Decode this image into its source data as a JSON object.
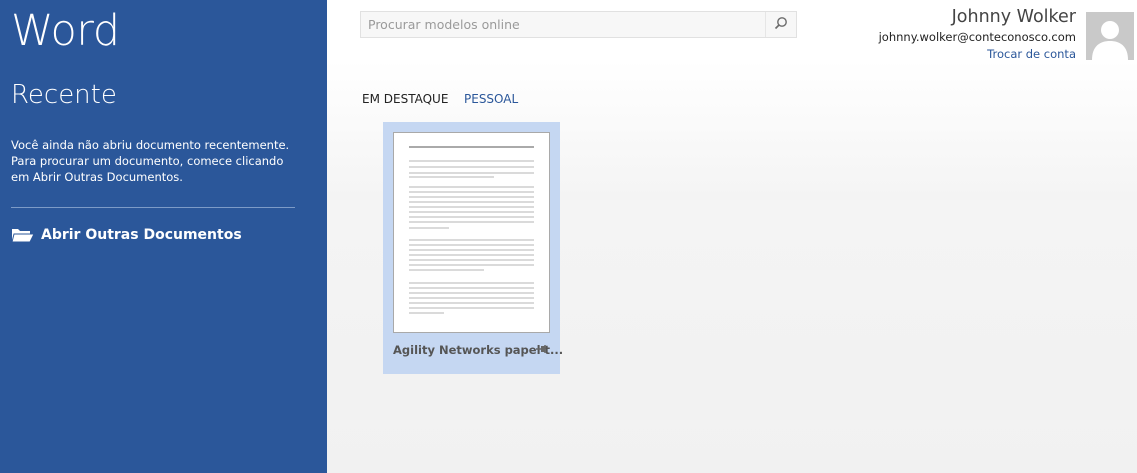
{
  "app": {
    "title": "Word"
  },
  "sidebar": {
    "recent_heading": "Recente",
    "recent_message": "Você ainda não abriu documento recentemente. Para procurar um documento, comece clicando em Abrir Outras Documentos.",
    "open_other_label": "Abrir Outras Documentos",
    "open_other_icon": "folder-open-icon",
    "background_color": "#2b579a"
  },
  "search": {
    "placeholder": "Procurar modelos online",
    "value": "",
    "icon": "search-icon"
  },
  "account": {
    "name": "Johnny Wolker",
    "email": "johnny.wolker@conteconosco.com",
    "switch_label": "Trocar de conta",
    "avatar_icon": "user-avatar-icon"
  },
  "tabs": [
    {
      "label": "EM DESTAQUE",
      "active": false
    },
    {
      "label": "PESSOAL",
      "active": true
    }
  ],
  "templates": [
    {
      "name": "Agility Networks papel t...",
      "selected": true,
      "pin_icon": "pin-icon"
    }
  ],
  "colors": {
    "accent": "#2b579a",
    "tile_selected": "#c5d7f2"
  }
}
